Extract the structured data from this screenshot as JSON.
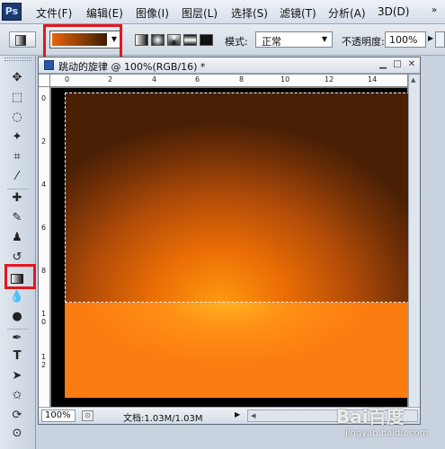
{
  "app": {
    "logo": "Ps"
  },
  "menu": {
    "items": [
      {
        "label": "文件(F)"
      },
      {
        "label": "编辑(E)"
      },
      {
        "label": "图像(I)"
      },
      {
        "label": "图层(L)"
      },
      {
        "label": "选择(S)"
      },
      {
        "label": "滤镜(T)"
      },
      {
        "label": "分析(A)"
      },
      {
        "label": "3D(D)"
      }
    ],
    "overflow": "»"
  },
  "options": {
    "gradient_colors": [
      "#e8650a",
      "#3d1d05"
    ],
    "gradient_arrow": "▼",
    "mode_label": "模式:",
    "mode_value": "正常",
    "opacity_label": "不透明度:",
    "opacity_value": "100%",
    "selected_gradient_type": "linear"
  },
  "document": {
    "title": "跳动的旋律 @ 100%(RGB/16) *",
    "controls": [
      "▁",
      "□",
      "✕"
    ],
    "hruler_labels": [
      "0",
      "2",
      "4",
      "6",
      "8",
      "10",
      "12",
      "14"
    ],
    "vruler_labels": [
      "0",
      "2",
      "4",
      "6",
      "8",
      "10",
      "12"
    ],
    "zoom": "100%",
    "doc_info": "文档:1.03M/1.03M",
    "status_arrow": "▶"
  },
  "accent": {
    "highlight": "#e2171d"
  },
  "watermark": {
    "logo": "Bai百度",
    "text": "jingyan.baidu.com"
  }
}
